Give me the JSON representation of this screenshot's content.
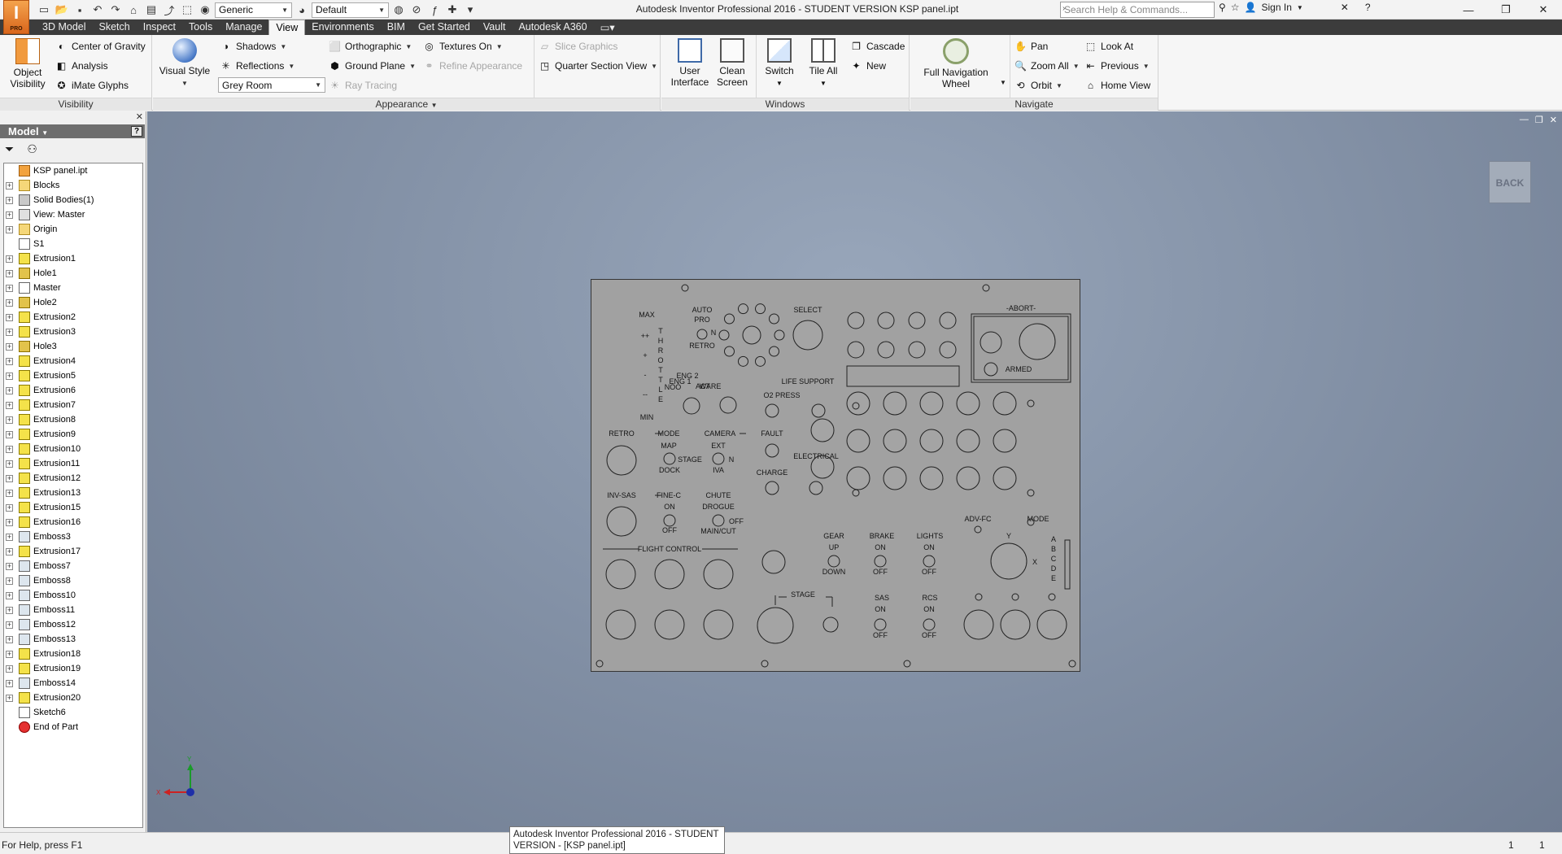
{
  "app_badge": "PRO",
  "window_title": "Autodesk Inventor Professional 2016 - STUDENT VERSION   KSP panel.ipt",
  "quick_access": {
    "material": "Generic",
    "appearance": "Default"
  },
  "search_placeholder": "Search Help & Commands...",
  "sign_in": "Sign In",
  "tabs": [
    "3D Model",
    "Sketch",
    "Inspect",
    "Tools",
    "Manage",
    "View",
    "Environments",
    "BIM",
    "Get Started",
    "Vault",
    "Autodesk A360"
  ],
  "ribbon": {
    "visibility": {
      "title": "Visibility",
      "object_visibility": "Object\nVisibility",
      "center_of_gravity": "Center of Gravity",
      "analysis": "Analysis",
      "imate_glyphs": "iMate Glyphs"
    },
    "appearance": {
      "title": "Appearance",
      "visual_style": "Visual Style",
      "shadows": "Shadows",
      "reflections": "Reflections",
      "lighting": "Grey Room",
      "orthographic": "Orthographic",
      "ground_plane": "Ground Plane",
      "ray_tracing": "Ray Tracing",
      "textures_on": "Textures On",
      "refine_appearance": "Refine Appearance",
      "slice_graphics": "Slice Graphics",
      "quarter_section": "Quarter Section View"
    },
    "windows": {
      "title": "Windows",
      "user_interface": "User\nInterface",
      "clean_screen": "Clean\nScreen",
      "switch": "Switch",
      "tile_all": "Tile All",
      "cascade": "Cascade",
      "new": "New"
    },
    "navigate": {
      "title": "Navigate",
      "full_nav_wheel": "Full Navigation\nWheel",
      "pan": "Pan",
      "zoom_all": "Zoom All",
      "orbit": "Orbit",
      "look_at": "Look At",
      "previous": "Previous",
      "home_view": "Home View"
    }
  },
  "browser": {
    "title": "Model",
    "help": "?",
    "items": [
      {
        "label": "KSP panel.ipt",
        "type": "part",
        "exp": false
      },
      {
        "label": "Blocks",
        "type": "folder",
        "exp": true
      },
      {
        "label": "Solid Bodies(1)",
        "type": "body",
        "exp": true
      },
      {
        "label": "View: Master",
        "type": "view",
        "exp": true
      },
      {
        "label": "Origin",
        "type": "folder",
        "exp": true
      },
      {
        "label": "S1",
        "type": "sketch",
        "exp": false
      },
      {
        "label": "Extrusion1",
        "type": "ext",
        "exp": true
      },
      {
        "label": "Hole1",
        "type": "hole",
        "exp": true
      },
      {
        "label": "Master",
        "type": "sketch",
        "exp": true
      },
      {
        "label": "Hole2",
        "type": "hole",
        "exp": true
      },
      {
        "label": "Extrusion2",
        "type": "ext",
        "exp": true
      },
      {
        "label": "Extrusion3",
        "type": "ext",
        "exp": true
      },
      {
        "label": "Hole3",
        "type": "hole",
        "exp": true
      },
      {
        "label": "Extrusion4",
        "type": "ext",
        "exp": true
      },
      {
        "label": "Extrusion5",
        "type": "ext",
        "exp": true
      },
      {
        "label": "Extrusion6",
        "type": "ext",
        "exp": true
      },
      {
        "label": "Extrusion7",
        "type": "ext",
        "exp": true
      },
      {
        "label": "Extrusion8",
        "type": "ext",
        "exp": true
      },
      {
        "label": "Extrusion9",
        "type": "ext",
        "exp": true
      },
      {
        "label": "Extrusion10",
        "type": "ext",
        "exp": true
      },
      {
        "label": "Extrusion11",
        "type": "ext",
        "exp": true
      },
      {
        "label": "Extrusion12",
        "type": "ext",
        "exp": true
      },
      {
        "label": "Extrusion13",
        "type": "ext",
        "exp": true
      },
      {
        "label": "Extrusion15",
        "type": "ext",
        "exp": true
      },
      {
        "label": "Extrusion16",
        "type": "ext",
        "exp": true
      },
      {
        "label": "Emboss3",
        "type": "emb",
        "exp": true
      },
      {
        "label": "Extrusion17",
        "type": "ext",
        "exp": true
      },
      {
        "label": "Emboss7",
        "type": "emb",
        "exp": true
      },
      {
        "label": "Emboss8",
        "type": "emb",
        "exp": true
      },
      {
        "label": "Emboss10",
        "type": "emb",
        "exp": true
      },
      {
        "label": "Emboss11",
        "type": "emb",
        "exp": true
      },
      {
        "label": "Emboss12",
        "type": "emb",
        "exp": true
      },
      {
        "label": "Emboss13",
        "type": "emb",
        "exp": true
      },
      {
        "label": "Extrusion18",
        "type": "ext",
        "exp": true
      },
      {
        "label": "Extrusion19",
        "type": "ext",
        "exp": true
      },
      {
        "label": "Emboss14",
        "type": "emb",
        "exp": true
      },
      {
        "label": "Extrusion20",
        "type": "ext",
        "exp": true
      },
      {
        "label": "Sketch6",
        "type": "sketch",
        "exp": false
      },
      {
        "label": "End of Part",
        "type": "end",
        "exp": false
      }
    ]
  },
  "viewport": {
    "back_label": "BACK",
    "axis_x": "X",
    "axis_y": "Y"
  },
  "panel_labels": {
    "max": "MAX",
    "min": "MIN",
    "auto": "AUTO",
    "pro": "PRO",
    "n": "N",
    "retro_small": "RETRO",
    "select": "SELECT",
    "throttle": "THROTTLE",
    "abort": "-ABORT-",
    "armed": "ARMED",
    "life_support": "LIFE SUPPORT",
    "eng1": "ENG 1",
    "eng2": "ENG 2",
    "noo": "NOO",
    "ware": "WARE",
    "act": "ACT",
    "o2_press": "O2 PRESS",
    "retro": "RETRO",
    "mode": "MODE",
    "camera": "CAMERA",
    "map": "MAP",
    "stage": "STAGE",
    "dock": "DOCK",
    "ext": "EXT",
    "n2": "N",
    "iva": "IVA",
    "fault": "FAULT",
    "electrical": "ELECTRICAL",
    "charge": "CHARGE",
    "inv_sas": "INV-SAS",
    "fine_c": "FINE-C",
    "chute": "CHUTE",
    "on": "ON",
    "off": "OFF",
    "drogue": "DROGUE",
    "main_cut": "MAIN/CUT",
    "flight_control": "FLIGHT CONTROL",
    "gear": "GEAR",
    "brake": "BRAKE",
    "lights": "LIGHTS",
    "up": "UP",
    "down": "DOWN",
    "adv_fc": "ADV-FC",
    "mode2": "MODE",
    "y": "Y",
    "x": "X",
    "abcde": "ABCDE",
    "stage_btn": "STAGE",
    "sas": "SAS",
    "rcs": "RCS",
    "plus_plus": "++",
    "plus": "+",
    "minus": "-",
    "minus_minus": "--"
  },
  "status": {
    "help": "For Help, press F1",
    "tooltip": "Autodesk Inventor Professional 2016 - STUDENT VERSION - [KSP panel.ipt]",
    "count1": "1",
    "count2": "1"
  }
}
